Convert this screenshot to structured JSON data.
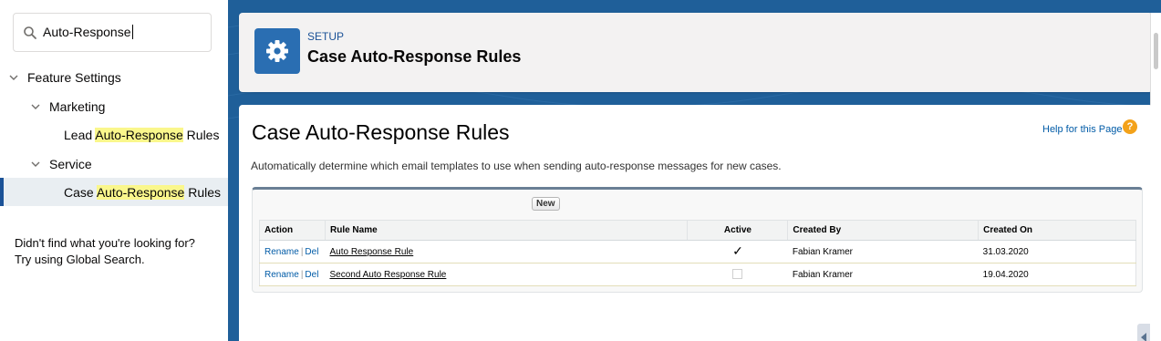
{
  "sidebar": {
    "search": {
      "value": "Auto-Response"
    },
    "tree": [
      {
        "label": "Feature Settings"
      },
      {
        "label": "Marketing"
      },
      {
        "pre": "Lead ",
        "match": "Auto-Response",
        "post": " Rules"
      },
      {
        "label": "Service"
      },
      {
        "pre": "Case ",
        "match": "Auto-Response",
        "post": " Rules"
      }
    ],
    "hint_line1": "Didn't find what you're looking for?",
    "hint_line2": "Try using Global Search."
  },
  "header": {
    "eyebrow": "SETUP",
    "title": "Case Auto-Response Rules",
    "icon": "gear-icon"
  },
  "content": {
    "title": "Case Auto-Response Rules",
    "help_label": "Help for this Page",
    "help_icon": "?",
    "description": "Automatically determine which email templates to use when sending auto-response messages for new cases.",
    "new_button": "New",
    "columns": [
      "Action",
      "Rule Name",
      "Active",
      "Created By",
      "Created On"
    ],
    "rows": [
      {
        "rename": "Rename",
        "sep": "|",
        "del": "Del",
        "name": "Auto Response Rule",
        "active_mark": "✓",
        "created_by": "Fabian Kramer",
        "created_on": "31.03.2020"
      },
      {
        "rename": "Rename",
        "sep": "|",
        "del": "Del",
        "name": "Second Auto Response Rule",
        "created_by": "Fabian Kramer",
        "created_on": "19.04.2020"
      }
    ]
  },
  "colors": {
    "accent": "#2a6eb2",
    "highlight": "#faf78c",
    "link": "#015ba7",
    "background": "#1f5f99"
  }
}
